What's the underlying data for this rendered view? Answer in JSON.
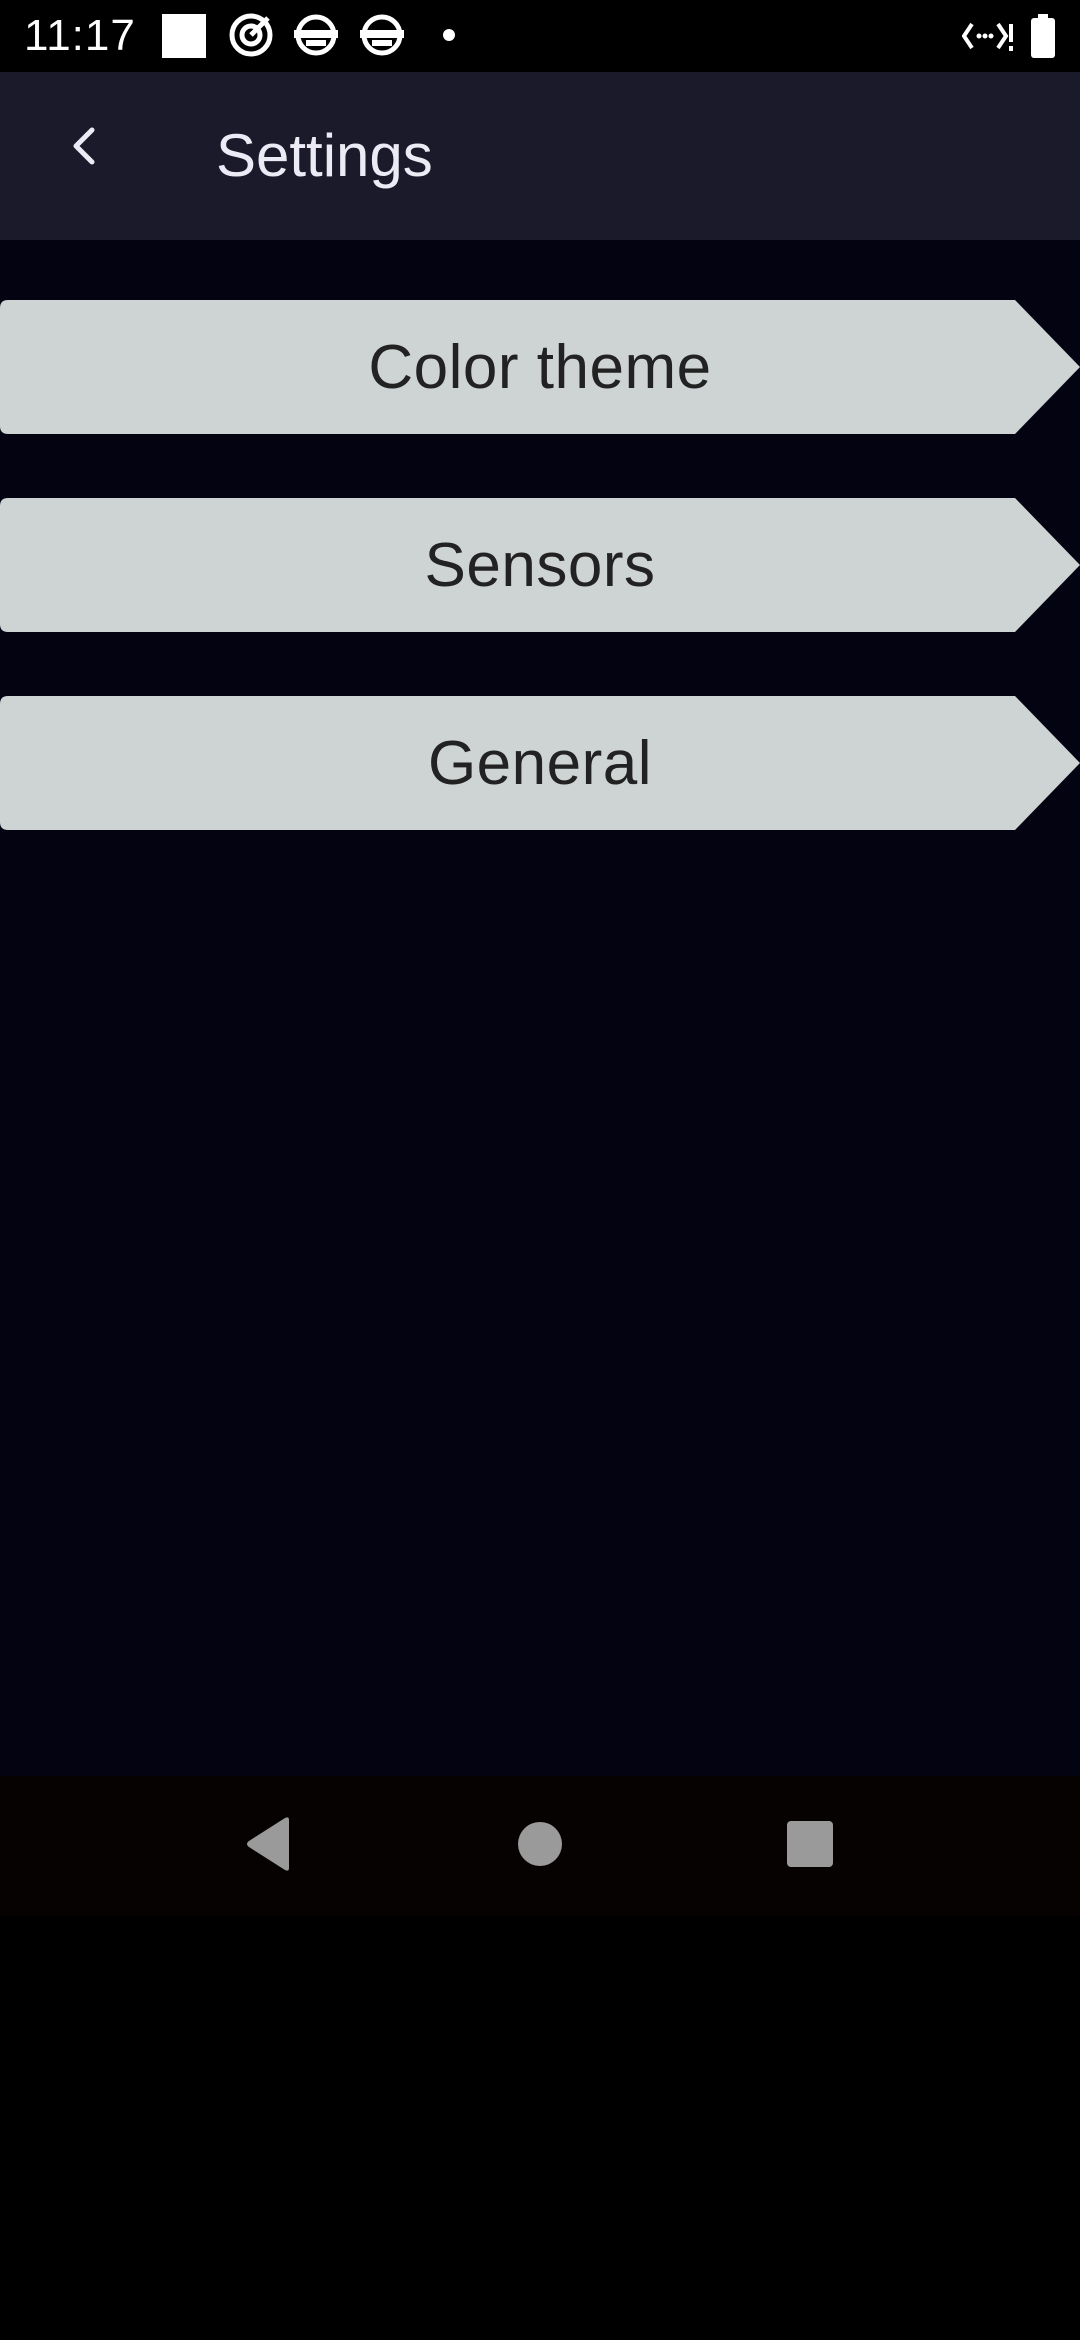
{
  "status_bar": {
    "time": "11:17",
    "icons": [
      "white-square-icon",
      "target-icon",
      "app-face-icon",
      "app-face-icon",
      "notification-dot-icon"
    ],
    "right_icons": [
      "data-arrows-icon",
      "battery-icon"
    ]
  },
  "app_bar": {
    "back_icon": "chevron-left-icon",
    "title": "Settings"
  },
  "menu": {
    "items": [
      {
        "label": "Color theme"
      },
      {
        "label": "Sensors"
      },
      {
        "label": "General"
      }
    ]
  },
  "nav_bar": {
    "buttons": [
      "back-triangle-icon",
      "home-circle-icon",
      "recents-square-icon"
    ]
  },
  "colors": {
    "status_bar_bg": "#000000",
    "app_bar_bg": "#1b1a2b",
    "content_bg": "#030312",
    "menu_item_bg": "#ced3d3",
    "menu_text": "#222222",
    "title_text": "#ecebf5",
    "nav_icon": "#9a9a9a"
  }
}
